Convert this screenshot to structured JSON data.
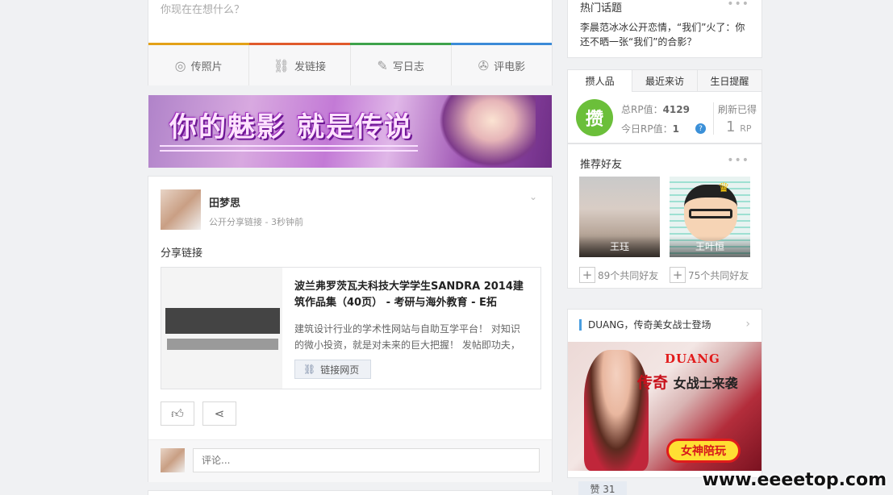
{
  "publisher": {
    "placeholder": "你现在在想什么？",
    "colors": [
      "#e3a118",
      "#e05a2c",
      "#3ea24b",
      "#3b8bd8"
    ],
    "actions": [
      {
        "label": "传照片",
        "icon": "camera-icon"
      },
      {
        "label": "发链接",
        "icon": "link-icon"
      },
      {
        "label": "写日志",
        "icon": "edit-icon"
      },
      {
        "label": "评电影",
        "icon": "film-icon"
      }
    ]
  },
  "banner": {
    "text": "你的魅影 就是传说"
  },
  "post": {
    "author": "田梦思",
    "meta": "公开分享链接 - 3秒钟前",
    "text": "分享链接",
    "link": {
      "title": "波兰弗罗茨瓦夫科技大学学生SANDRA 2014建筑作品集（40页） - 考研与海外教育 - E拓",
      "description": "建筑设计行业的学术性网站与自助互学平台！ 对知识的微小投资，就是对未来的巨大把握！ 发帖即功夫，",
      "button_label": "链接网页"
    },
    "comment_placeholder": "评论..."
  },
  "hot_topics": {
    "title": "热门话题",
    "text": "李晨范冰冰公开恋情，“我们”火了：你还不晒一张“我们”的合影？"
  },
  "rp": {
    "tabs": [
      "攒人品",
      "最近来访",
      "生日提醒"
    ],
    "badge": "攒",
    "total_label": "总RP值：",
    "total_value": "4129",
    "today_label": "今日RP值：",
    "today_value": "1",
    "refresh_label": "刷新已得",
    "refresh_value": "1",
    "refresh_unit": "RP"
  },
  "friends": {
    "title": "推荐好友",
    "items": [
      {
        "name": "王珏",
        "mutual": "89个共同好友"
      },
      {
        "name": "王叶恒",
        "mutual": "75个共同好友"
      }
    ]
  },
  "ad": {
    "title": "DUANG，传奇美女战士登场",
    "brand": "DUANG",
    "headline_main": "传奇",
    "headline_sub": "女战士来袭",
    "cta": "女神陪玩"
  },
  "likes": "赞 31",
  "watermark": "www.eeeetop.com"
}
